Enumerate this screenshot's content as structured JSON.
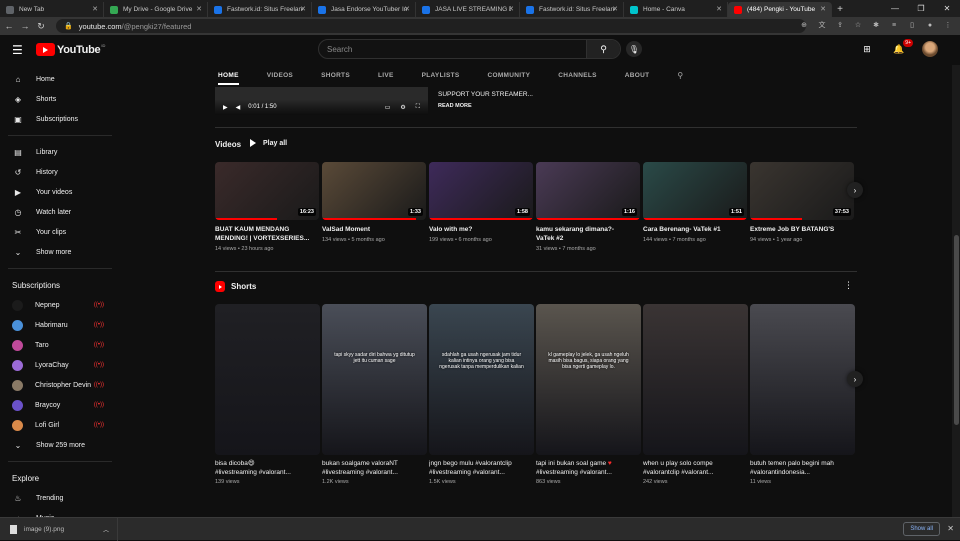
{
  "browser": {
    "tabs": [
      {
        "label": "New Tab",
        "color": "#5f6368",
        "active": false
      },
      {
        "label": "My Drive - Google Drive",
        "color": "#34a853",
        "active": false
      },
      {
        "label": "Fastwork.id: Situs Freelanc",
        "color": "#1a73e8",
        "active": false
      },
      {
        "label": "Jasa Endorse YouTuber Ini",
        "color": "#1a73e8",
        "active": false
      },
      {
        "label": "JASA LIVE STREAMING DI",
        "color": "#1a73e8",
        "active": false
      },
      {
        "label": "Fastwork.id: Situs Freelanc",
        "color": "#1a73e8",
        "active": false
      },
      {
        "label": "Home - Canva",
        "color": "#00c4cc",
        "active": false
      },
      {
        "label": "(484) Pengki - YouTube",
        "color": "#ff0000",
        "active": true
      }
    ],
    "url_host": "youtube.com",
    "url_path": "/@pengki27/featured",
    "new_tab": "+"
  },
  "header": {
    "logo_text": "YouTube",
    "logo_region": "ID",
    "search_placeholder": "Search",
    "notification_count": "9+"
  },
  "sidebar": {
    "main": [
      {
        "label": "Home",
        "icon": "home-icon",
        "glyph": "⌂"
      },
      {
        "label": "Shorts",
        "icon": "shorts-icon",
        "glyph": "◈"
      },
      {
        "label": "Subscriptions",
        "icon": "subscriptions-icon",
        "glyph": "▣"
      }
    ],
    "library": [
      {
        "label": "Library",
        "icon": "library-icon",
        "glyph": "▤"
      },
      {
        "label": "History",
        "icon": "history-icon",
        "glyph": "↺"
      },
      {
        "label": "Your videos",
        "icon": "your-videos-icon",
        "glyph": "▶"
      },
      {
        "label": "Watch later",
        "icon": "watch-later-icon",
        "glyph": "◷"
      },
      {
        "label": "Your clips",
        "icon": "clips-icon",
        "glyph": "✂"
      },
      {
        "label": "Show more",
        "icon": "chevron-down-icon",
        "glyph": "⌄"
      }
    ],
    "subscriptions_title": "Subscriptions",
    "subscriptions": [
      {
        "label": "Nepnep",
        "color": "#1b1b1b",
        "live": true
      },
      {
        "label": "Habrimaru",
        "color": "#4a90d9",
        "live": true
      },
      {
        "label": "Taro",
        "color": "#c04a9a",
        "live": true
      },
      {
        "label": "LyoraChay",
        "color": "#9b6bd6",
        "live": true
      },
      {
        "label": "Christopher Devin",
        "color": "#8a7a66",
        "live": true
      },
      {
        "label": "Braycoy",
        "color": "#6b52c9",
        "live": true
      },
      {
        "label": "Lofi Girl",
        "color": "#d98a4a",
        "live": true
      }
    ],
    "show_more_subs": "Show 259 more",
    "explore_title": "Explore",
    "explore": [
      {
        "label": "Trending",
        "icon": "trending-icon",
        "glyph": "♨"
      },
      {
        "label": "Music",
        "icon": "music-icon",
        "glyph": "♪"
      }
    ]
  },
  "channel_nav": {
    "tabs": [
      {
        "label": "HOME",
        "active": true
      },
      {
        "label": "VIDEOS",
        "active": false
      },
      {
        "label": "SHORTS",
        "active": false
      },
      {
        "label": "LIVE",
        "active": false
      },
      {
        "label": "PLAYLISTS",
        "active": false
      },
      {
        "label": "COMMUNITY",
        "active": false
      },
      {
        "label": "CHANNELS",
        "active": false
      },
      {
        "label": "ABOUT",
        "active": false
      }
    ]
  },
  "featured": {
    "time": "0:01 / 1:50",
    "description": "SUPPORT YOUR STREAMER...",
    "read_more": "READ MORE"
  },
  "videos": {
    "title": "Videos",
    "play_all": "Play all",
    "items": [
      {
        "title_l1": "BUAT KAUM MENDANG",
        "title_l2": "MENDING! | VORTEXSERIES...",
        "meta": "14 views • 23 hours ago",
        "duration": "16:23",
        "progress": 0.6,
        "bg": "#3a2a2a"
      },
      {
        "title_l1": "ValSad Moment",
        "title_l2": "",
        "meta": "134 views • 5 months ago",
        "duration": "1:33",
        "progress": 0.9,
        "bg": "#5a4a38"
      },
      {
        "title_l1": "Valo with me?",
        "title_l2": "",
        "meta": "199 views • 6 months ago",
        "duration": "1:58",
        "progress": 1.0,
        "bg": "#3e2a5a"
      },
      {
        "title_l1": "kamu sekarang dimana?-",
        "title_l2": "VaTek #2",
        "meta": "31 views • 7 months ago",
        "duration": "1:16",
        "progress": 1.0,
        "bg": "#4a3a55"
      },
      {
        "title_l1": "Cara Berenang- VaTek #1",
        "title_l2": "",
        "meta": "144 views • 7 months ago",
        "duration": "1:51",
        "progress": 1.0,
        "bg": "#2a4a48"
      },
      {
        "title_l1": "Extreme Job BY BATANG'S",
        "title_l2": "",
        "meta": "94 views • 1 year ago",
        "duration": "37:53",
        "progress": 0.5,
        "bg": "#3a3530"
      }
    ]
  },
  "shorts": {
    "title": "Shorts",
    "items": [
      {
        "title_l1": "bisa dicoba😄",
        "title_l2": "#livestreaming #valorant...",
        "meta": "139 views",
        "heart": false,
        "caption": "",
        "bg": "#202024"
      },
      {
        "title_l1": "bukan soalgame valoraNT",
        "title_l2": "#livestreaming #valorant...",
        "meta": "1.2K views",
        "heart": false,
        "caption": "tapi skyy sadar diri bahwa yg ditutup jett itu cuman sage",
        "bg": "#4a4e58"
      },
      {
        "title_l1": "jngn bego mulu #valorantclip",
        "title_l2": "#livestreaming #valorant...",
        "meta": "1.5K views",
        "heart": false,
        "caption": "sdahlah ga usah ngerusak jam tidur kalian intinya orang yang bisa ngerusak tanpa memperdulikan kalian",
        "bg": "#3a4650"
      },
      {
        "title_l1": "tapi ini bukan soal game",
        "title_l2": "#livestreaming #valorant...",
        "meta": "863 views",
        "heart": true,
        "caption": "kl gameplay lo jelek, ga usah ngeluh masih bisa bagus, siapa orang yang bisa ngerti gameplay lo.",
        "bg": "#5a554e"
      },
      {
        "title_l1": "when u play solo compe",
        "title_l2": "#valorantclip #valorant...",
        "meta": "242 views",
        "heart": false,
        "caption": "",
        "bg": "#3a3434"
      },
      {
        "title_l1": "butuh temen palo begini mah",
        "title_l2": "#valorantindonesia...",
        "meta": "11 views",
        "heart": false,
        "caption": "",
        "bg": "#4a4a50"
      }
    ]
  },
  "download": {
    "file": "image (9).png",
    "show_all": "Show all"
  }
}
